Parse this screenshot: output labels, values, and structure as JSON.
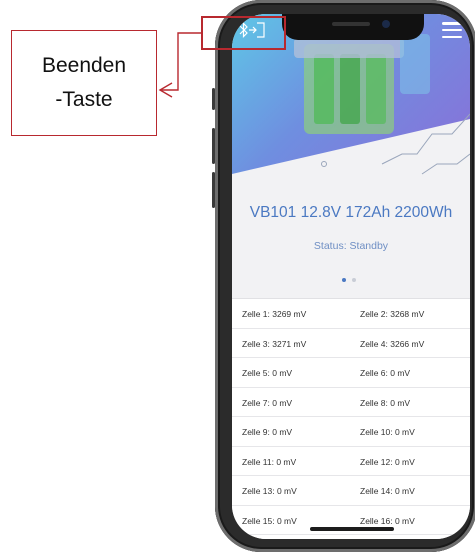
{
  "annotation": {
    "line1": "Beenden",
    "line2": "-Taste",
    "color": "#b8292f"
  },
  "app": {
    "exit_icon": "bluetooth-exit-icon",
    "menu_icon": "hamburger-menu-icon",
    "battery_title": "VB101 12.8V 172Ah 2200Wh",
    "status": "Status: Standby",
    "page_dots": {
      "count": 2,
      "active": 0
    },
    "cells": [
      [
        "Zelle 1: 3269 mV",
        "Zelle 2: 3268 mV"
      ],
      [
        "Zelle 3: 3271 mV",
        "Zelle 4: 3266 mV"
      ],
      [
        "Zelle 5: 0 mV",
        "Zelle 6: 0 mV"
      ],
      [
        "Zelle 7: 0 mV",
        "Zelle 8: 0 mV"
      ],
      [
        "Zelle 9: 0 mV",
        "Zelle 10: 0 mV"
      ],
      [
        "Zelle 11: 0 mV",
        "Zelle 12: 0 mV"
      ],
      [
        "Zelle 13: 0 mV",
        "Zelle 14: 0 mV"
      ],
      [
        "Zelle 15: 0 mV",
        "Zelle 16: 0 mV"
      ]
    ],
    "accent": "#4b79c2"
  }
}
